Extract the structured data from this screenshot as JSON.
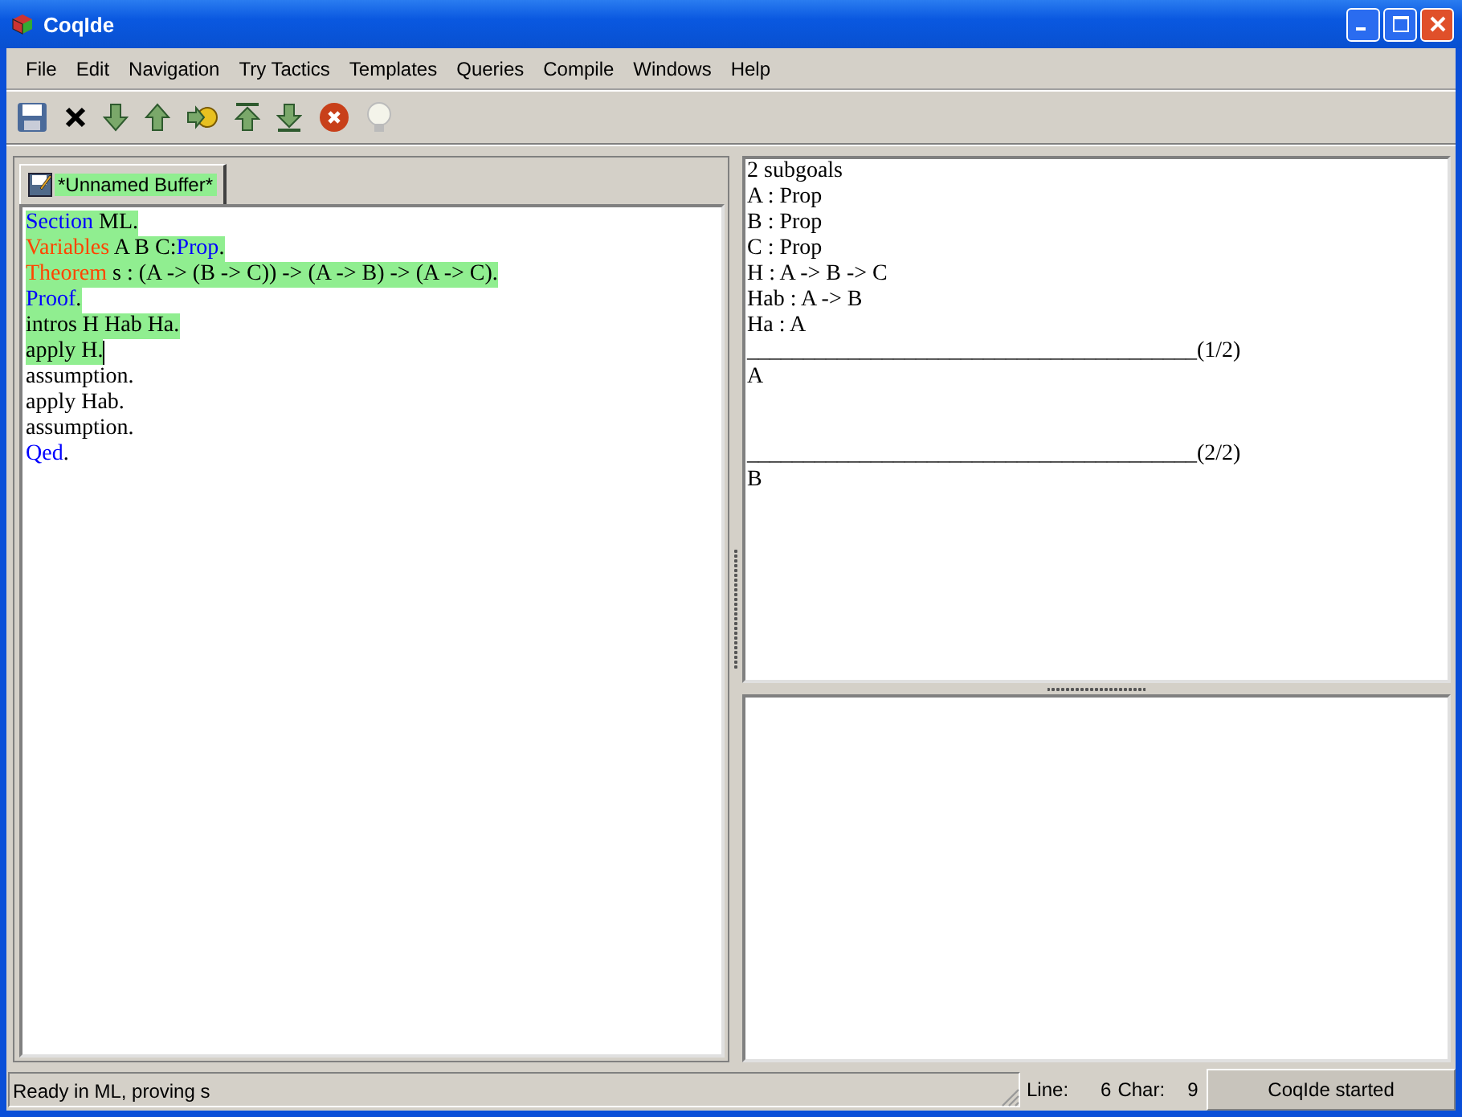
{
  "window": {
    "title": "CoqIde"
  },
  "menu": [
    {
      "label": "File"
    },
    {
      "label": "Edit"
    },
    {
      "label": "Navigation"
    },
    {
      "label": "Try Tactics"
    },
    {
      "label": "Templates"
    },
    {
      "label": "Queries"
    },
    {
      "label": "Compile"
    },
    {
      "label": "Windows"
    },
    {
      "label": "Help"
    }
  ],
  "toolbar": [
    {
      "kind": "save"
    },
    {
      "kind": "close"
    },
    {
      "kind": "down"
    },
    {
      "kind": "up"
    },
    {
      "kind": "goto"
    },
    {
      "kind": "top"
    },
    {
      "kind": "bottom"
    },
    {
      "kind": "stop"
    },
    {
      "kind": "hint"
    }
  ],
  "tabs": [
    {
      "label": "*Unnamed Buffer*",
      "selected": true
    }
  ],
  "editor": {
    "lines": [
      {
        "processed": true,
        "cursor": false,
        "segments": [
          {
            "kind": "command",
            "text": "Section"
          },
          {
            "kind": "plain",
            "text": " ML."
          }
        ]
      },
      {
        "processed": true,
        "cursor": false,
        "segments": [
          {
            "kind": "declaration",
            "text": "Variables"
          },
          {
            "kind": "plain",
            "text": " A B C:"
          },
          {
            "kind": "command",
            "text": "Prop"
          },
          {
            "kind": "plain",
            "text": "."
          }
        ]
      },
      {
        "processed": true,
        "cursor": false,
        "segments": [
          {
            "kind": "declaration",
            "text": "Theorem"
          },
          {
            "kind": "plain",
            "text": " s : (A -> (B -> C)) -> (A -> B) -> (A -> C)."
          }
        ]
      },
      {
        "processed": true,
        "cursor": false,
        "segments": [
          {
            "kind": "command",
            "text": "Proof"
          },
          {
            "kind": "plain",
            "text": "."
          }
        ]
      },
      {
        "processed": true,
        "cursor": false,
        "segments": [
          {
            "kind": "plain",
            "text": "intros H Hab Ha."
          }
        ]
      },
      {
        "processed": true,
        "cursor": true,
        "segments": [
          {
            "kind": "plain",
            "text": "apply H."
          }
        ]
      },
      {
        "processed": false,
        "cursor": false,
        "segments": [
          {
            "kind": "plain",
            "text": "assumption."
          }
        ]
      },
      {
        "processed": false,
        "cursor": false,
        "segments": [
          {
            "kind": "plain",
            "text": "apply Hab."
          }
        ]
      },
      {
        "processed": false,
        "cursor": false,
        "segments": [
          {
            "kind": "plain",
            "text": "assumption."
          }
        ]
      },
      {
        "processed": false,
        "cursor": false,
        "segments": [
          {
            "kind": "command",
            "text": "Qed"
          },
          {
            "kind": "plain",
            "text": "."
          }
        ]
      }
    ]
  },
  "goals": {
    "header": "2 subgoals",
    "hypotheses": [
      "A : Prop",
      "B : Prop",
      "C : Prop",
      "H : A -> B -> C",
      "Hab : A -> B",
      "Ha : A"
    ],
    "subgoals": [
      {
        "separator": "________________________________________(1/2)",
        "goal": "A"
      },
      {
        "separator": "________________________________________(2/2)",
        "goal": "B"
      }
    ]
  },
  "status_bar": {
    "message": "Ready in ML, proving s",
    "line_label": "Line:",
    "line": "6",
    "char_label": "Char:",
    "char": "9",
    "info": "CoqIde started"
  }
}
